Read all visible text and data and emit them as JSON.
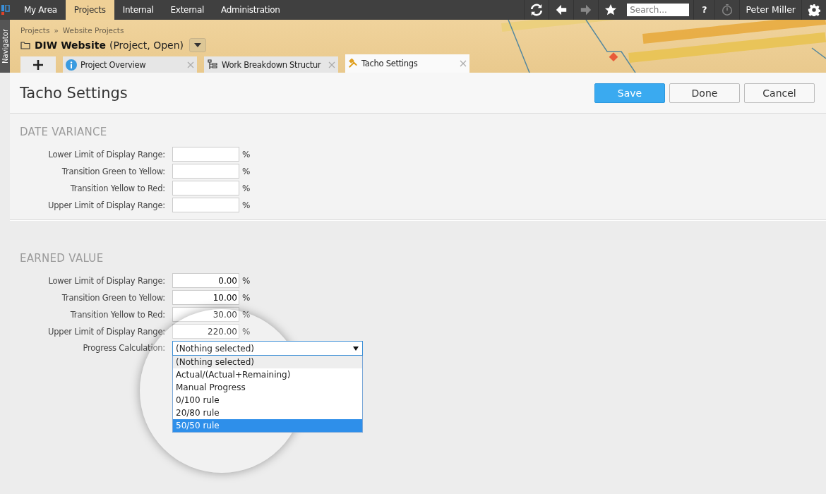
{
  "top_nav": {
    "items": [
      {
        "label": "My Area",
        "selected": false
      },
      {
        "label": "Projects",
        "selected": true
      },
      {
        "label": "Internal",
        "selected": false
      },
      {
        "label": "External",
        "selected": false
      },
      {
        "label": "Administration",
        "selected": false
      }
    ],
    "search": {
      "placeholder": "Search..."
    },
    "user": "Peter Miller",
    "help": "?"
  },
  "navigator": "Navigator",
  "breadcrumb": [
    "Projects",
    "»",
    "Website Projects"
  ],
  "project": {
    "name": "DIW Website",
    "info": "(Project, Open)"
  },
  "tabs": [
    {
      "label": "Project Overview",
      "selected": false
    },
    {
      "label": "Work Breakdown Structur",
      "selected": false
    },
    {
      "label": "Tacho Settings",
      "selected": true
    }
  ],
  "page_title": "Tacho Settings",
  "buttons": [
    {
      "label": "Save",
      "primary": true
    },
    {
      "label": "Done",
      "primary": false
    },
    {
      "label": "Cancel",
      "primary": false
    }
  ],
  "sections": [
    {
      "title": "DATE VARIANCE",
      "fields": [
        {
          "label": "Lower Limit of Display Range:",
          "unit": "%"
        },
        {
          "label": "Transition Green to Yellow:",
          "unit": "%"
        },
        {
          "label": "Transition Yellow to Red:",
          "unit": "%"
        },
        {
          "label": "Upper Limit of Display Range:",
          "unit": "%"
        }
      ]
    },
    {
      "title": "EARNED VALUE",
      "fields": [
        {
          "label": "Lower Limit of Display Range:",
          "value": "0.00",
          "unit": "%"
        },
        {
          "label": "Transition Green to Yellow:",
          "value": "10.00",
          "unit": "%"
        },
        {
          "label": "Transition Yellow to Red:",
          "value": "30.00",
          "unit": "%"
        },
        {
          "label": "Upper Limit of Display Range:",
          "value": "220.00",
          "unit": "%"
        }
      ],
      "dropdown": {
        "label": "Progress Calculation:",
        "value": "(Nothing selected)",
        "options": [
          {
            "label": "(Nothing selected)",
            "selected": true,
            "highlighted": false
          },
          {
            "label": "Actual/(Actual+Remaining)",
            "selected": false,
            "highlighted": false
          },
          {
            "label": "Manual Progress",
            "selected": false,
            "highlighted": false
          },
          {
            "label": "0/100 rule",
            "selected": false,
            "highlighted": false
          },
          {
            "label": "20/80 rule",
            "selected": false,
            "highlighted": false
          },
          {
            "label": "50/50 rule",
            "selected": false,
            "highlighted": true
          }
        ]
      }
    }
  ]
}
